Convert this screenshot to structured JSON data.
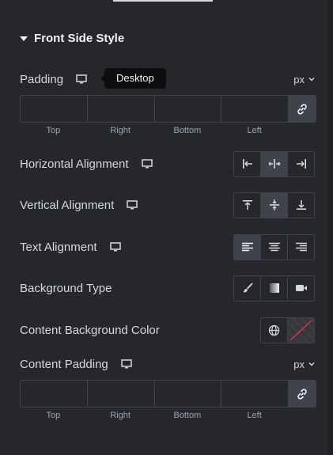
{
  "section": {
    "title": "Front Side Style"
  },
  "tooltip": {
    "text": "Desktop"
  },
  "padding": {
    "label": "Padding",
    "unit": "px",
    "sides": [
      "Top",
      "Right",
      "Bottom",
      "Left"
    ]
  },
  "horizontal_alignment": {
    "label": "Horizontal Alignment",
    "options": [
      "left",
      "center",
      "right"
    ],
    "selected": "center"
  },
  "vertical_alignment": {
    "label": "Vertical Alignment",
    "options": [
      "top",
      "middle",
      "bottom"
    ],
    "selected": "middle"
  },
  "text_alignment": {
    "label": "Text Alignment",
    "options": [
      "left",
      "center",
      "right"
    ],
    "selected": "left"
  },
  "background_type": {
    "label": "Background Type",
    "options": [
      "classic",
      "gradient",
      "video"
    ]
  },
  "content_background_color": {
    "label": "Content Background Color"
  },
  "content_padding": {
    "label": "Content Padding",
    "unit": "px",
    "sides": [
      "Top",
      "Right",
      "Bottom",
      "Left"
    ]
  },
  "colors": {
    "panel": "#26272b",
    "border": "#3f444b",
    "active": "#3f444b",
    "text": "#d5d8dc",
    "tooltip_bg": "#0c0d0e",
    "clear_line": "#e0353f"
  },
  "icons": [
    "monitor-icon",
    "link-icon",
    "globe-icon",
    "brush-icon",
    "gradient-icon",
    "video-icon",
    "chevron-down-icon",
    "caret-down-icon"
  ]
}
